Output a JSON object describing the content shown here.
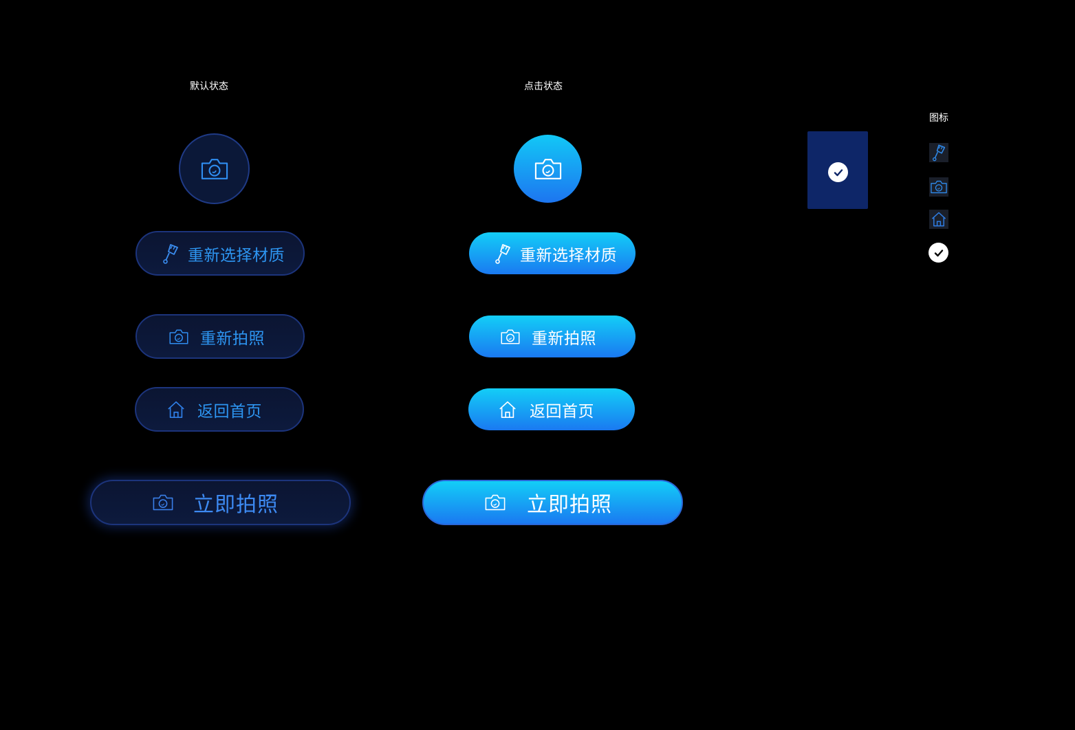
{
  "columns": {
    "default_title": "默认状态",
    "active_title": "点击状态",
    "icons_title": "图标"
  },
  "buttons": {
    "reselect_material": "重新选择材质",
    "retake_photo": "重新拍照",
    "back_home": "返回首页",
    "take_photo_now": "立即拍照"
  },
  "icons": {
    "camera": "camera-icon",
    "brush": "brush-icon",
    "home": "home-icon",
    "check": "check-icon"
  },
  "colors": {
    "background": "#000000",
    "default_fill": "#0b1838",
    "default_border": "#1f3a86",
    "default_text": "#2d95f1",
    "active_gradient_top": "#13cef7",
    "active_gradient_bottom": "#1a79f1",
    "panel": "#0e2668"
  }
}
